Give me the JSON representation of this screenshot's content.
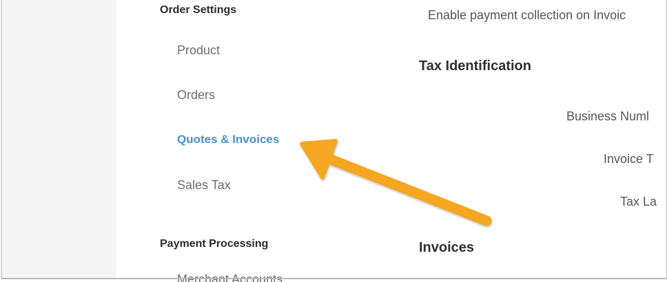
{
  "sidebar": {
    "order_settings_heading": "Order Settings",
    "items": [
      {
        "label": "Product"
      },
      {
        "label": "Orders"
      },
      {
        "label": "Quotes & Invoices"
      },
      {
        "label": "Sales Tax"
      }
    ],
    "payment_processing_heading": "Payment Processing",
    "partial_item_label": "Merchant Accounts"
  },
  "content": {
    "payment_collection_text": "Enable payment collection on Invoic",
    "tax_identification_heading": "Tax Identification",
    "business_number_label": "Business Numl",
    "invoice_label": "Invoice T",
    "tax_label": "Tax La",
    "invoices_heading": "Invoices"
  },
  "annotation": {
    "arrow_color": "#f5a623",
    "arrow_target": "Quotes & Invoices"
  },
  "colors": {
    "active_link": "#4a8fd3",
    "inactive_link": "#6e6e6e",
    "heading": "#2b2b2b"
  }
}
